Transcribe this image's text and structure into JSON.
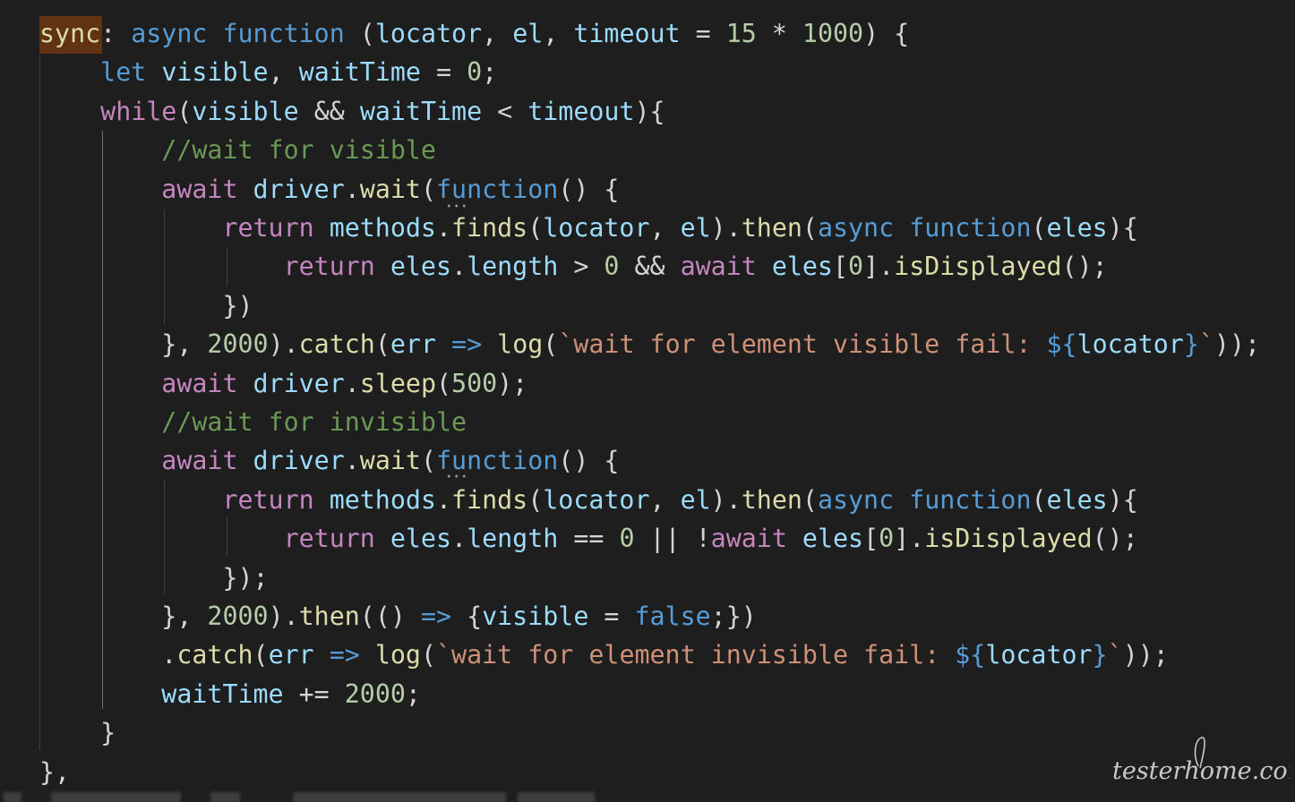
{
  "theme": {
    "background": "#1e1e1e",
    "colors": {
      "kw": "#569cd6",
      "ctrl": "#c586c0",
      "var": "#9cdcfe",
      "fn": "#dcdcaa",
      "num": "#b5cea8",
      "str": "#ce9178",
      "cmt": "#6a9955",
      "punc": "#d4d4d4",
      "hl": "#dcdcaa"
    }
  },
  "code": {
    "lines": [
      [
        [
          "sync",
          "hl"
        ],
        [
          ": ",
          "punc"
        ],
        [
          "async",
          "kw"
        ],
        [
          " ",
          "punc"
        ],
        [
          "function",
          "kw"
        ],
        [
          " (",
          "punc"
        ],
        [
          "locator",
          "var"
        ],
        [
          ", ",
          "punc"
        ],
        [
          "el",
          "var"
        ],
        [
          ", ",
          "punc"
        ],
        [
          "timeout",
          "var"
        ],
        [
          " = ",
          "punc"
        ],
        [
          "15",
          "num"
        ],
        [
          " * ",
          "punc"
        ],
        [
          "1000",
          "num"
        ],
        [
          ") {",
          "punc"
        ]
      ],
      [
        [
          "    ",
          "punc"
        ],
        [
          "let",
          "kw"
        ],
        [
          " ",
          "punc"
        ],
        [
          "visible",
          "var"
        ],
        [
          ", ",
          "punc"
        ],
        [
          "waitTime",
          "var"
        ],
        [
          " = ",
          "punc"
        ],
        [
          "0",
          "num"
        ],
        [
          ";",
          "punc"
        ]
      ],
      [
        [
          "    ",
          "punc"
        ],
        [
          "while",
          "ctrl"
        ],
        [
          "(",
          "punc"
        ],
        [
          "visible",
          "var"
        ],
        [
          " && ",
          "punc"
        ],
        [
          "waitTime",
          "var"
        ],
        [
          " < ",
          "punc"
        ],
        [
          "timeout",
          "var"
        ],
        [
          "){",
          "punc"
        ]
      ],
      [
        [
          "        ",
          "punc"
        ],
        [
          "//wait for visible",
          "cmt"
        ]
      ],
      [
        [
          "        ",
          "punc"
        ],
        [
          "await",
          "ctrl"
        ],
        [
          " ",
          "punc"
        ],
        [
          "driver",
          "var"
        ],
        [
          ".",
          "punc"
        ],
        [
          "wait",
          "fn"
        ],
        [
          "(",
          "punc"
        ],
        [
          "function",
          "kw"
        ],
        [
          "() {",
          "punc"
        ]
      ],
      [
        [
          "            ",
          "punc"
        ],
        [
          "return",
          "ctrl"
        ],
        [
          " ",
          "punc"
        ],
        [
          "methods",
          "var"
        ],
        [
          ".",
          "punc"
        ],
        [
          "finds",
          "fn"
        ],
        [
          "(",
          "punc"
        ],
        [
          "locator",
          "var"
        ],
        [
          ", ",
          "punc"
        ],
        [
          "el",
          "var"
        ],
        [
          ").",
          "punc"
        ],
        [
          "then",
          "fn"
        ],
        [
          "(",
          "punc"
        ],
        [
          "async",
          "kw"
        ],
        [
          " ",
          "punc"
        ],
        [
          "function",
          "kw"
        ],
        [
          "(",
          "punc"
        ],
        [
          "eles",
          "var"
        ],
        [
          "){",
          "punc"
        ]
      ],
      [
        [
          "                ",
          "punc"
        ],
        [
          "return",
          "ctrl"
        ],
        [
          " ",
          "punc"
        ],
        [
          "eles",
          "var"
        ],
        [
          ".",
          "punc"
        ],
        [
          "length",
          "var"
        ],
        [
          " > ",
          "punc"
        ],
        [
          "0",
          "num"
        ],
        [
          " && ",
          "punc"
        ],
        [
          "await",
          "ctrl"
        ],
        [
          " ",
          "punc"
        ],
        [
          "eles",
          "var"
        ],
        [
          "[",
          "punc"
        ],
        [
          "0",
          "num"
        ],
        [
          "].",
          "punc"
        ],
        [
          "isDisplayed",
          "fn"
        ],
        [
          "();",
          "punc"
        ]
      ],
      [
        [
          "            ",
          "punc"
        ],
        [
          "})",
          "punc"
        ]
      ],
      [
        [
          "        ",
          "punc"
        ],
        [
          "}, ",
          "punc"
        ],
        [
          "2000",
          "num"
        ],
        [
          ").",
          "punc"
        ],
        [
          "catch",
          "fn"
        ],
        [
          "(",
          "punc"
        ],
        [
          "err",
          "var"
        ],
        [
          " ",
          "punc"
        ],
        [
          "=>",
          "kw"
        ],
        [
          " ",
          "punc"
        ],
        [
          "log",
          "fn"
        ],
        [
          "(",
          "punc"
        ],
        [
          "`wait for element visible fail: ",
          "str"
        ],
        [
          "${",
          "kw"
        ],
        [
          "locator",
          "var"
        ],
        [
          "}",
          "kw"
        ],
        [
          "`",
          "str"
        ],
        [
          "));",
          "punc"
        ]
      ],
      [
        [
          "        ",
          "punc"
        ],
        [
          "await",
          "ctrl"
        ],
        [
          " ",
          "punc"
        ],
        [
          "driver",
          "var"
        ],
        [
          ".",
          "punc"
        ],
        [
          "sleep",
          "fn"
        ],
        [
          "(",
          "punc"
        ],
        [
          "500",
          "num"
        ],
        [
          ");",
          "punc"
        ]
      ],
      [
        [
          "        ",
          "punc"
        ],
        [
          "//wait for invisible",
          "cmt"
        ]
      ],
      [
        [
          "        ",
          "punc"
        ],
        [
          "await",
          "ctrl"
        ],
        [
          " ",
          "punc"
        ],
        [
          "driver",
          "var"
        ],
        [
          ".",
          "punc"
        ],
        [
          "wait",
          "fn"
        ],
        [
          "(",
          "punc"
        ],
        [
          "function",
          "kw"
        ],
        [
          "() {",
          "punc"
        ]
      ],
      [
        [
          "            ",
          "punc"
        ],
        [
          "return",
          "ctrl"
        ],
        [
          " ",
          "punc"
        ],
        [
          "methods",
          "var"
        ],
        [
          ".",
          "punc"
        ],
        [
          "finds",
          "fn"
        ],
        [
          "(",
          "punc"
        ],
        [
          "locator",
          "var"
        ],
        [
          ", ",
          "punc"
        ],
        [
          "el",
          "var"
        ],
        [
          ").",
          "punc"
        ],
        [
          "then",
          "fn"
        ],
        [
          "(",
          "punc"
        ],
        [
          "async",
          "kw"
        ],
        [
          " ",
          "punc"
        ],
        [
          "function",
          "kw"
        ],
        [
          "(",
          "punc"
        ],
        [
          "eles",
          "var"
        ],
        [
          "){",
          "punc"
        ]
      ],
      [
        [
          "                ",
          "punc"
        ],
        [
          "return",
          "ctrl"
        ],
        [
          " ",
          "punc"
        ],
        [
          "eles",
          "var"
        ],
        [
          ".",
          "punc"
        ],
        [
          "length",
          "var"
        ],
        [
          " == ",
          "punc"
        ],
        [
          "0",
          "num"
        ],
        [
          " || !",
          "punc"
        ],
        [
          "await",
          "ctrl"
        ],
        [
          " ",
          "punc"
        ],
        [
          "eles",
          "var"
        ],
        [
          "[",
          "punc"
        ],
        [
          "0",
          "num"
        ],
        [
          "].",
          "punc"
        ],
        [
          "isDisplayed",
          "fn"
        ],
        [
          "();",
          "punc"
        ]
      ],
      [
        [
          "            ",
          "punc"
        ],
        [
          "});",
          "punc"
        ]
      ],
      [
        [
          "        ",
          "punc"
        ],
        [
          "}, ",
          "punc"
        ],
        [
          "2000",
          "num"
        ],
        [
          ").",
          "punc"
        ],
        [
          "then",
          "fn"
        ],
        [
          "(() ",
          "punc"
        ],
        [
          "=>",
          "kw"
        ],
        [
          " {",
          "punc"
        ],
        [
          "visible",
          "var"
        ],
        [
          " = ",
          "punc"
        ],
        [
          "false",
          "kw"
        ],
        [
          ";})",
          "punc"
        ]
      ],
      [
        [
          "        ",
          "punc"
        ],
        [
          ".",
          "punc"
        ],
        [
          "catch",
          "fn"
        ],
        [
          "(",
          "punc"
        ],
        [
          "err",
          "var"
        ],
        [
          " ",
          "punc"
        ],
        [
          "=>",
          "kw"
        ],
        [
          " ",
          "punc"
        ],
        [
          "log",
          "fn"
        ],
        [
          "(",
          "punc"
        ],
        [
          "`wait for element invisible fail: ",
          "str"
        ],
        [
          "${",
          "kw"
        ],
        [
          "locator",
          "var"
        ],
        [
          "}",
          "kw"
        ],
        [
          "`",
          "str"
        ],
        [
          "));",
          "punc"
        ]
      ],
      [
        [
          "        ",
          "punc"
        ],
        [
          "waitTime",
          "var"
        ],
        [
          " += ",
          "punc"
        ],
        [
          "2000",
          "num"
        ],
        [
          ";",
          "punc"
        ]
      ],
      [
        [
          "    ",
          "punc"
        ],
        [
          "}",
          "punc"
        ]
      ],
      [
        [
          "},",
          "punc"
        ]
      ]
    ]
  },
  "watermark": {
    "text": "testerhome.com",
    "color": "#c8c8c8"
  }
}
